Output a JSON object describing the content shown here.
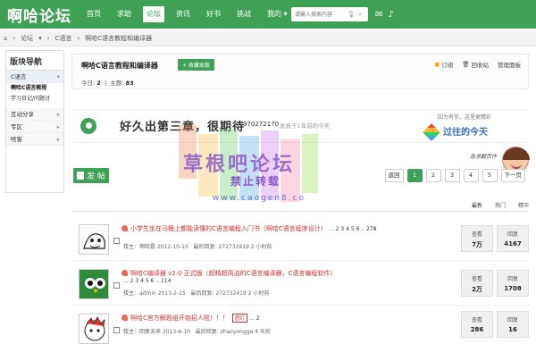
{
  "header": {
    "logo": "啊哈论坛",
    "nav": [
      "首页",
      "求助",
      "论坛",
      "资讯",
      "好书",
      "挑战",
      "我的"
    ],
    "active_nav": "论坛",
    "search_placeholder": "请输入搜索内容"
  },
  "breadcrumb": {
    "items": [
      "论坛",
      "C语言",
      "啊哈C语言教程和编译器"
    ]
  },
  "sidebar": {
    "title": "版块导航",
    "groups": [
      {
        "label": "C语言",
        "subs": [
          "啊哈C语言教程",
          "学习日记/问题讨"
        ]
      },
      {
        "label": "互动分享"
      },
      {
        "label": "专区"
      },
      {
        "label": "啥客"
      }
    ]
  },
  "board": {
    "name": "啊哈C语言教程和编译器",
    "fav_label": "+ 收藏本版",
    "today_label": "今日:",
    "today_value": "2",
    "topics_label": "主题:",
    "topics_value": "83",
    "actions": [
      "订阅",
      "回收站",
      "管理面板"
    ]
  },
  "announcement": {
    "heading": "好久出第三章，很期待",
    "user": "970272170",
    "time": "发表于1年前的今天"
  },
  "history": {
    "small": "因为有你，这里更精彩",
    "big": "过往的今天"
  },
  "handwriting": "急求翻页作",
  "toolbar": {
    "post_label": "发 帖",
    "pager": [
      "返回",
      "1",
      "2",
      "3",
      "4",
      "5",
      "下一页"
    ],
    "current_page": "1"
  },
  "sort_tabs": [
    "最新",
    "热门",
    "精华"
  ],
  "threads": [
    {
      "title": "小学生坐在马桶上都能读懂的C语言编程入门书（啊哈C语言程序设计）",
      "pages": "... 2 3 4 5 6 .. 278",
      "author": "楼主：啊哈磊",
      "posted": "2012-10-10",
      "last_reply": "最后回复: 272732419 2 小时前",
      "views_label": "查看",
      "views": "7万",
      "replies_label": "回复",
      "replies": "4167"
    },
    {
      "title": "啊哈C编译器 v2.0 正式版（超精超简洁的C语言编译器，C语言编程软件）",
      "pages": "... 2 3 4 5 6 .. 114",
      "author": "楼主：admin",
      "posted": "2013-2-15",
      "last_reply": "最后回复: 272732419 2 小时前",
      "views_label": "查看",
      "views": "2万",
      "replies_label": "回复",
      "replies": "1708"
    },
    {
      "title": "啊哈C官方解题组开始招人啦！！！",
      "tag": "图钉",
      "pages": "... 2",
      "author": "楼主：回复未来",
      "posted": "2013-6-10",
      "last_reply": "最后回复: zhaoyongge 4 天前",
      "views_label": "查看",
      "views": "286",
      "replies_label": "回复",
      "replies": "16"
    }
  ],
  "watermark": {
    "line1": "草根吧论坛",
    "line2": "禁止转载",
    "line3": "www.caogen8.co"
  }
}
